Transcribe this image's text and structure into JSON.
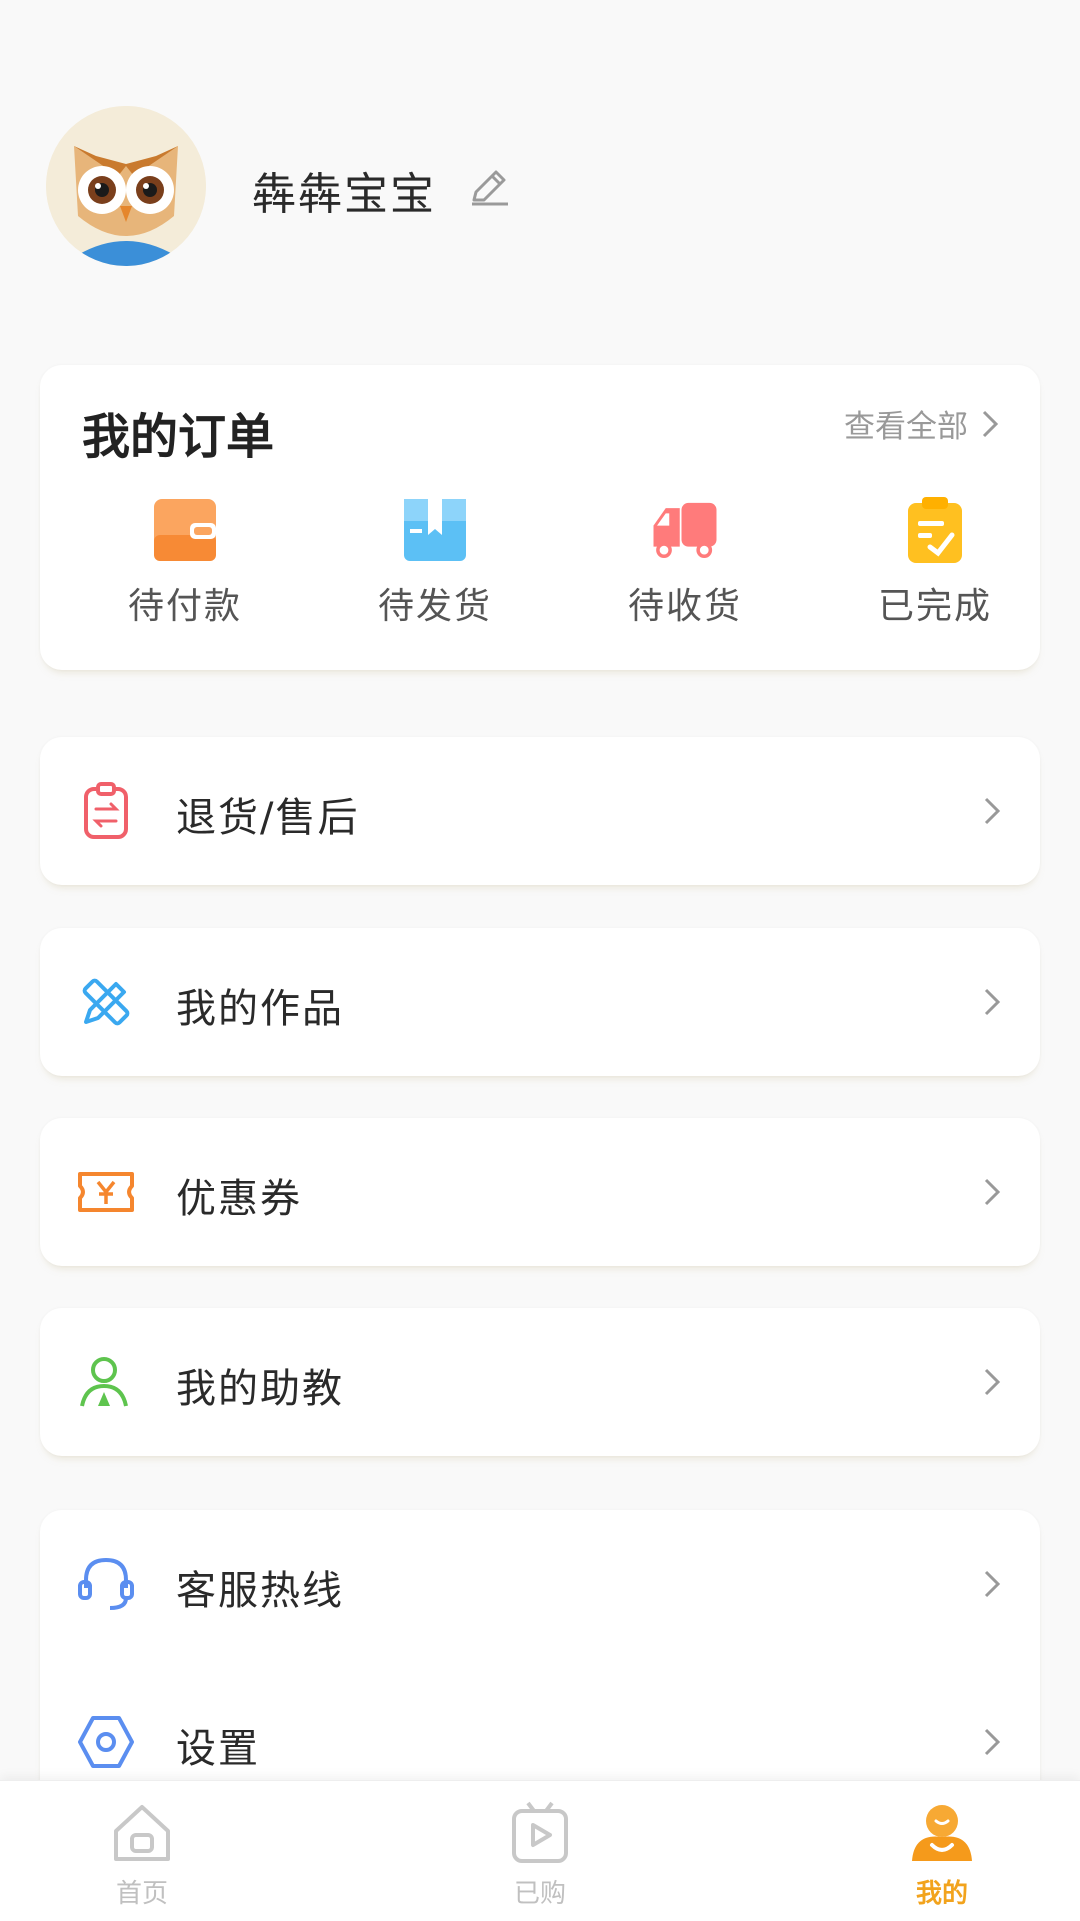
{
  "profile": {
    "username": "犇犇宝宝"
  },
  "orders": {
    "title": "我的订单",
    "view_all": "查看全部",
    "items": [
      {
        "label": "待付款",
        "icon": "wallet-icon"
      },
      {
        "label": "待发货",
        "icon": "package-icon"
      },
      {
        "label": "待收货",
        "icon": "truck-icon"
      },
      {
        "label": "已完成",
        "icon": "clipboard-check-icon"
      }
    ]
  },
  "menu": {
    "refund": {
      "label": "退货/售后",
      "icon": "refund-clipboard-icon"
    },
    "works": {
      "label": "我的作品",
      "icon": "pencil-ruler-icon"
    },
    "coupons": {
      "label": "优惠券",
      "icon": "coupon-icon"
    },
    "assistant": {
      "label": "我的助教",
      "icon": "teacher-icon"
    },
    "hotline": {
      "label": "客服热线",
      "icon": "headset-icon"
    },
    "settings": {
      "label": "设置",
      "icon": "settings-hexagon-icon"
    }
  },
  "tabbar": {
    "tabs": [
      {
        "label": "首页",
        "icon": "home-icon",
        "active": false
      },
      {
        "label": "已购",
        "icon": "purchased-tv-icon",
        "active": false
      },
      {
        "label": "我的",
        "icon": "mine-icon",
        "active": true
      }
    ]
  },
  "colors": {
    "accent": "#f2a31d",
    "text": "#222222",
    "muted": "#999999",
    "inactive_tab": "#c0c0c0"
  }
}
